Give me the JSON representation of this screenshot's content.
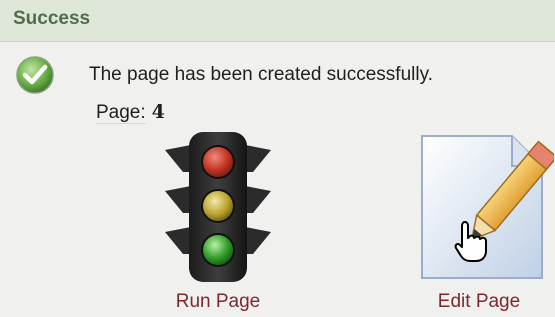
{
  "header": {
    "title": "Success"
  },
  "message": {
    "text": "The page has been created successfully.",
    "page_label": "Page:",
    "page_value": "4"
  },
  "actions": [
    {
      "label": "Run Page",
      "icon": "traffic-light-icon"
    },
    {
      "label": "Edit Page",
      "icon": "edit-page-icon"
    }
  ],
  "colors": {
    "header_bg": "#dfe7d9",
    "header_text": "#4f6d4a",
    "action_label": "#7a2a2a"
  }
}
